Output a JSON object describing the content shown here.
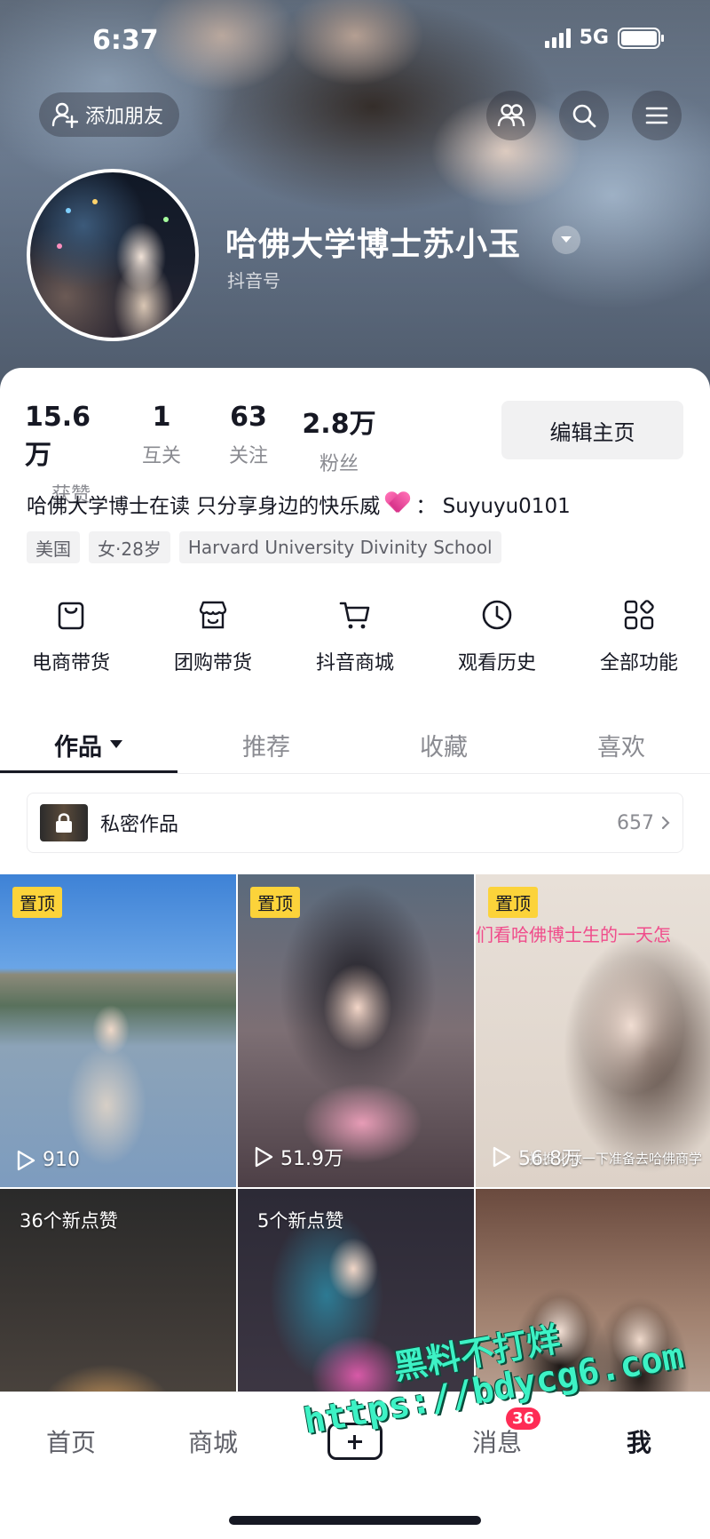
{
  "status_bar": {
    "time": "6:37",
    "network": "5G"
  },
  "header": {
    "add_friend_label": "添加朋友",
    "username": "哈佛大学博士苏小玉",
    "douyin_id_label": "抖音号"
  },
  "stats": [
    {
      "value": "15.6万",
      "label": "获赞"
    },
    {
      "value": "1",
      "label": "互关"
    },
    {
      "value": "63",
      "label": "关注"
    },
    {
      "value": "2.8万",
      "label": "粉丝"
    }
  ],
  "edit_profile_label": "编辑主页",
  "bio": {
    "text": "哈佛大学博士在读 只分享身边的快乐威",
    "suffix": "： Suyuyu0101"
  },
  "tags": [
    "美国",
    "女·28岁",
    "Harvard University Divinity School"
  ],
  "features": [
    {
      "label": "电商带货",
      "icon": "shopping-bag-icon"
    },
    {
      "label": "团购带货",
      "icon": "storefront-icon"
    },
    {
      "label": "抖音商城",
      "icon": "cart-icon"
    },
    {
      "label": "观看历史",
      "icon": "clock-icon"
    },
    {
      "label": "全部功能",
      "icon": "grid-icon"
    }
  ],
  "tabs": [
    {
      "label": "作品",
      "active": true
    },
    {
      "label": "推荐",
      "active": false
    },
    {
      "label": "收藏",
      "active": false
    },
    {
      "label": "喜欢",
      "active": false
    }
  ],
  "private_works": {
    "label": "私密作品",
    "count": "657"
  },
  "works": [
    {
      "badge": "置顶",
      "plays": "910"
    },
    {
      "badge": "置顶",
      "plays": "51.9万"
    },
    {
      "badge": "置顶",
      "plays": "56.8万",
      "overlay_text": "们看哈佛博士生的一天怎",
      "subtitle": "推推化妆一下准备去哈佛商学"
    },
    {
      "new_likes": "36个新点赞"
    },
    {
      "new_likes": "5个新点赞"
    },
    {}
  ],
  "watermark": {
    "line1": "黑料不打烊",
    "line2": "https://bdycg6.com"
  },
  "bottom_nav": [
    {
      "label": "首页"
    },
    {
      "label": "商城"
    },
    {
      "label": ""
    },
    {
      "label": "消息",
      "badge": "36"
    },
    {
      "label": "我"
    }
  ],
  "colors": {
    "accent_red": "#fe2c55",
    "pin_badge": "#fcd33a",
    "text_primary": "#161823",
    "text_secondary": "#8a8b91"
  }
}
